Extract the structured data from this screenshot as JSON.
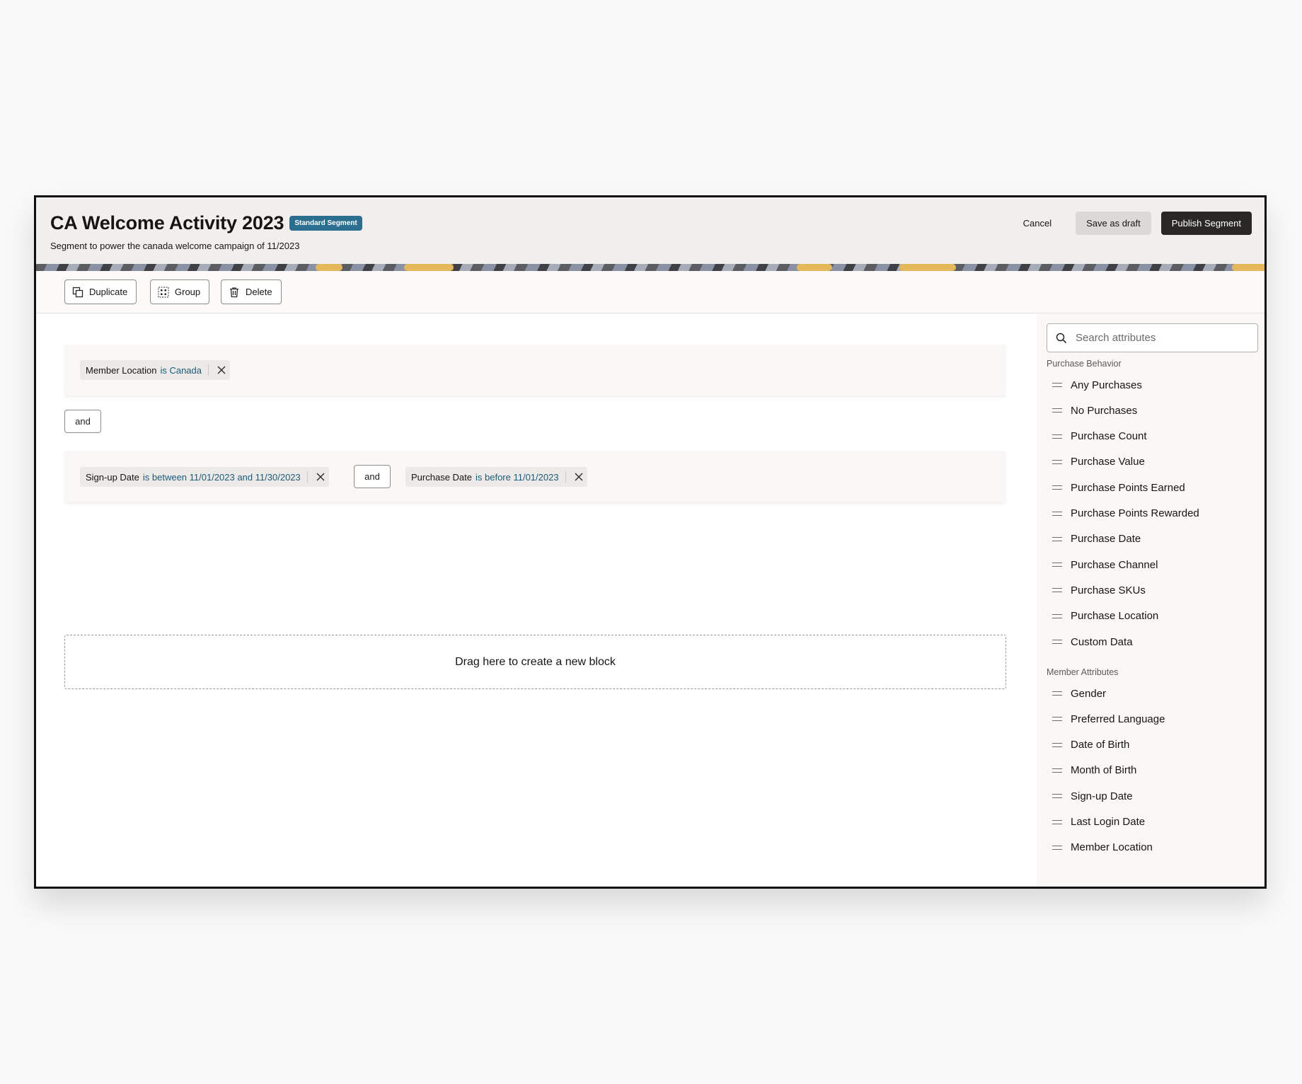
{
  "header": {
    "title": "CA Welcome Activity 2023",
    "badge": "Standard Segment",
    "subtitle": "Segment to power the canada welcome campaign of 11/2023",
    "cancel_label": "Cancel",
    "draft_label": "Save as draft",
    "publish_label": "Publish Segment"
  },
  "toolbar": {
    "duplicate_label": "Duplicate",
    "group_label": "Group",
    "delete_label": "Delete"
  },
  "rules": {
    "block1": {
      "chip1": {
        "attribute": "Member Location",
        "condition": "is Canada"
      }
    },
    "connector1": "and",
    "block2": {
      "chip1": {
        "attribute": "Sign-up Date",
        "condition": "is between 11/01/2023 and 11/30/2023"
      },
      "connector": "and",
      "chip2": {
        "attribute": "Purchase Date",
        "condition": "is before 11/01/2023"
      }
    },
    "dropzone_text": "Drag here to create a new block"
  },
  "sidebar": {
    "search_placeholder": "Search attributes",
    "sections": [
      {
        "label": "Purchase Behavior",
        "items": [
          "Any Purchases",
          "No Purchases",
          "Purchase Count",
          "Purchase Value",
          "Purchase Points Earned",
          "Purchase Points Rewarded",
          "Purchase Date",
          "Purchase Channel",
          "Purchase SKUs",
          "Purchase Location",
          "Custom Data"
        ]
      },
      {
        "label": "Member Attributes",
        "items": [
          "Gender",
          "Preferred Language",
          "Date of Birth",
          "Month of Birth",
          "Sign-up Date",
          "Last Login Date",
          "Member Location"
        ]
      }
    ]
  },
  "colors": {
    "badge": "#2b6e8f",
    "condition_text": "#1d5a7a",
    "publish_button": "#2a2826",
    "banner_accent": "#e5b95b"
  }
}
